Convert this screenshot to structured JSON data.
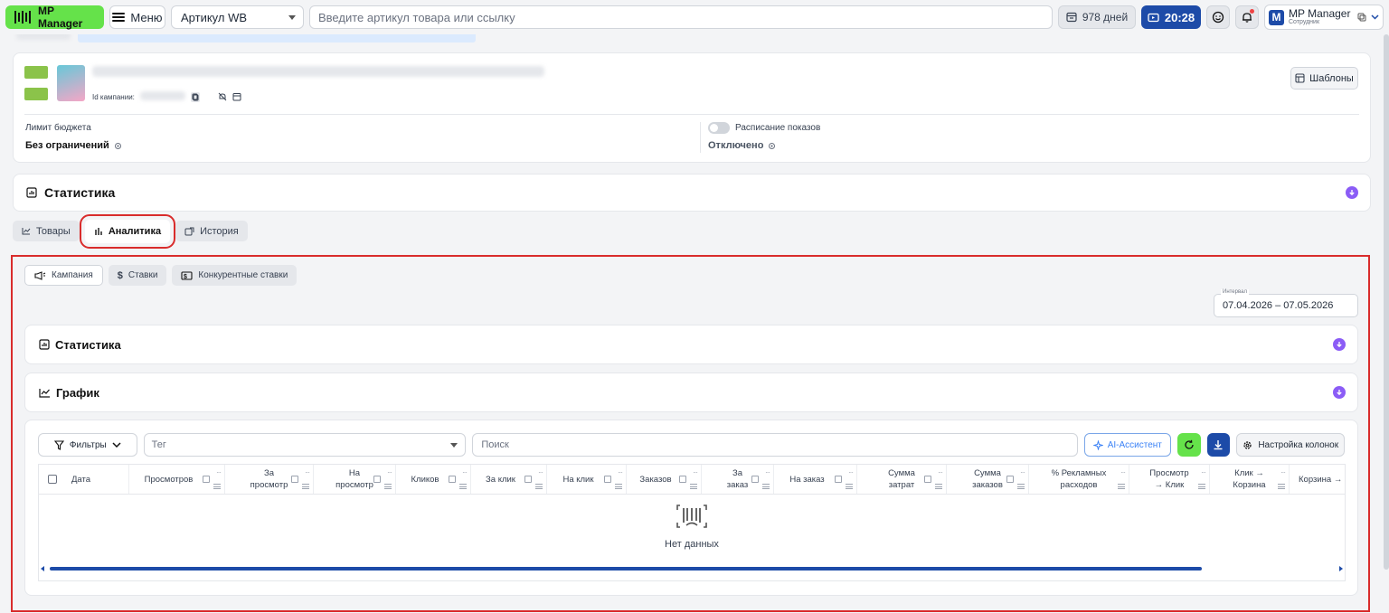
{
  "topbar": {
    "brand": "MP Manager",
    "menu_label": "Меню",
    "article_select": "Артикул WB",
    "search_placeholder": "Введите артикул товара или ссылку",
    "days_label": "978 дней",
    "time_label": "20:28",
    "user_name": "MP Manager",
    "user_role": "Сотрудник",
    "user_initial": "M"
  },
  "campaign": {
    "id_label": "Id кампании:",
    "templates_button": "Шаблоны",
    "budget_label": "Лимит бюджета",
    "budget_value": "Без ограничений",
    "schedule_label": "Расписание показов",
    "schedule_value": "Отключено"
  },
  "stats_card": {
    "title": "Статистика"
  },
  "tabs": [
    {
      "label": "Товары",
      "icon": "line-chart-icon"
    },
    {
      "label": "Аналитика",
      "icon": "bar-chart-icon",
      "active": true
    },
    {
      "label": "История",
      "icon": "history-icon"
    }
  ],
  "subtabs": [
    {
      "label": "Кампания",
      "icon": "megaphone-icon",
      "active": true
    },
    {
      "label": "Ставки",
      "icon": "dollar-icon"
    },
    {
      "label": "Конкурентные ставки",
      "icon": "dollar-box-icon"
    }
  ],
  "interval": {
    "label": "Интервал",
    "value": "07.04.2026 – 07.05.2026"
  },
  "analytics_stats": {
    "title": "Статистика"
  },
  "chart_section": {
    "title": "График"
  },
  "table_toolbar": {
    "filters_label": "Фильтры",
    "tag_placeholder": "Тег",
    "search_placeholder": "Поиск",
    "ai_label": "AI-Ассистент",
    "columns_label": "Настройка колонок"
  },
  "table": {
    "columns": [
      "Дата",
      "Просмотров",
      "За просмотр",
      "На просмотр",
      "Кликов",
      "За клик",
      "На клик",
      "Заказов",
      "За заказ",
      "На заказ",
      "Сумма затрат",
      "Сумма заказов",
      "% Рекламных расходов",
      "Просмотр → Клик",
      "Клик → Корзина",
      "Корзина → Заказ"
    ],
    "empty_text": "Нет данных"
  },
  "colors": {
    "brand_green": "#65e24a",
    "brand_blue": "#1d4ba8",
    "accent_purple": "#8b5cf6",
    "highlight_red": "#d92c2c"
  }
}
